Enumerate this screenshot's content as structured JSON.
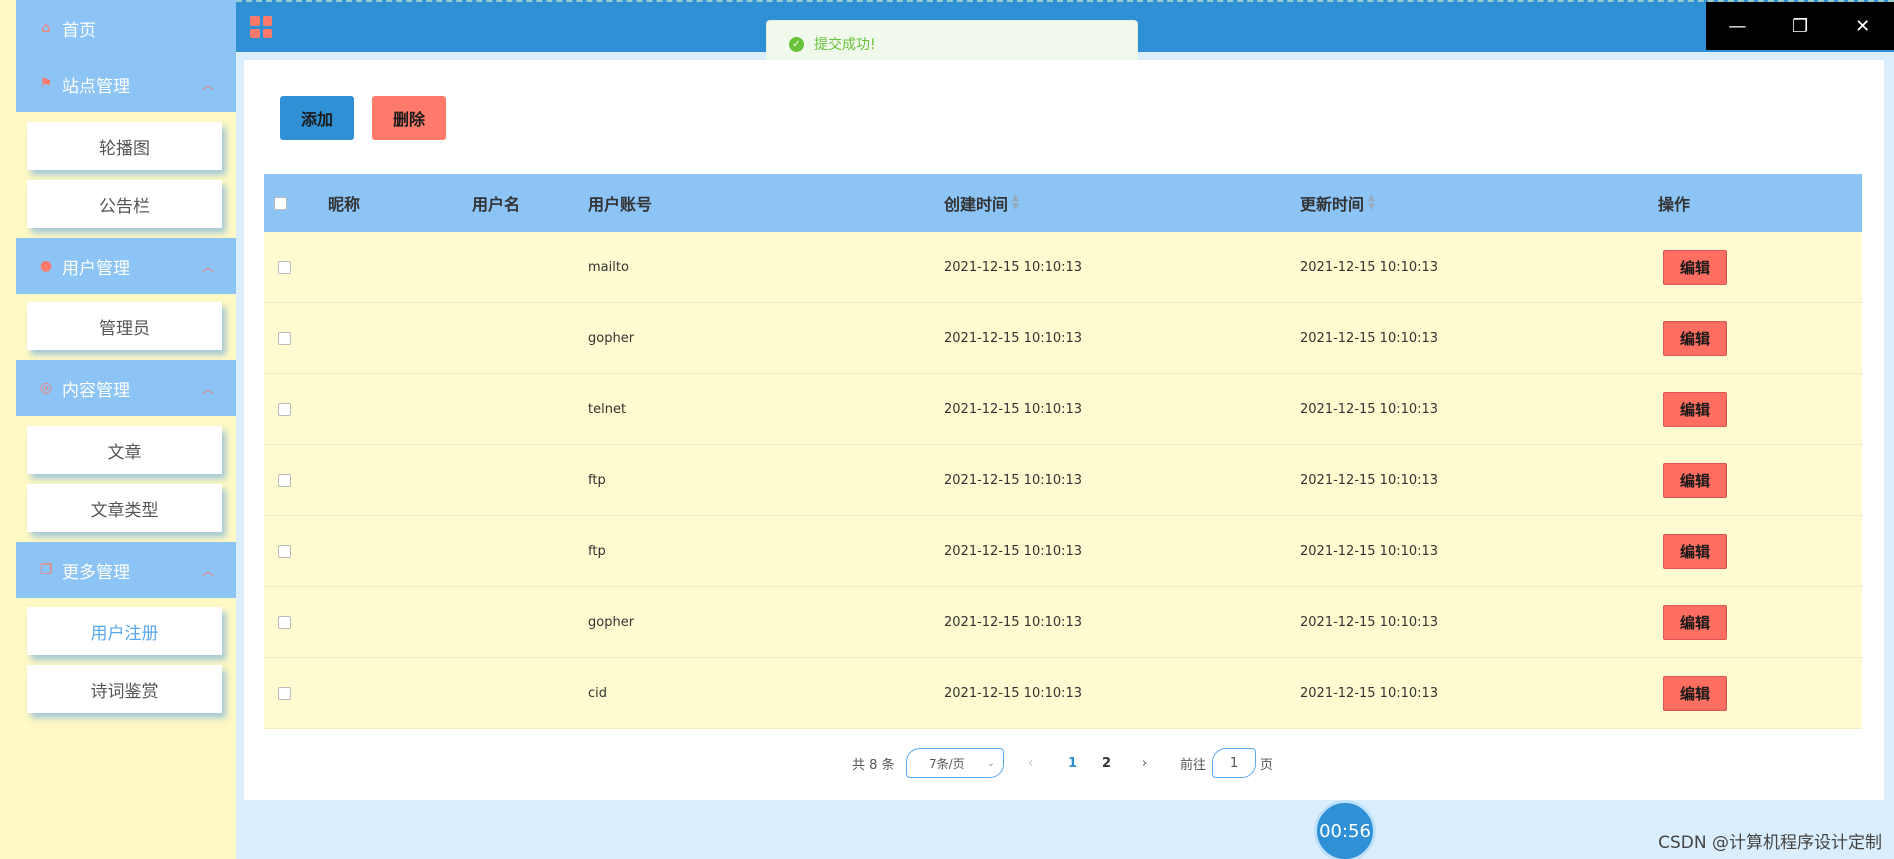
{
  "sidebar": {
    "home": "首页",
    "groups": [
      {
        "label": "站点管理",
        "items": [
          "轮播图",
          "公告栏"
        ]
      },
      {
        "label": "用户管理",
        "items": [
          "管理员"
        ]
      },
      {
        "label": "内容管理",
        "items": [
          "文章",
          "文章类型"
        ]
      },
      {
        "label": "更多管理",
        "items": [
          "用户注册",
          "诗词鉴赏"
        ]
      }
    ]
  },
  "toast": {
    "message": "提交成功!"
  },
  "toolbar": {
    "add_label": "添加",
    "delete_label": "删除"
  },
  "table": {
    "columns": [
      "昵称",
      "用户名",
      "用户账号",
      "创建时间",
      "更新时间",
      "操作"
    ],
    "rows": [
      {
        "nickname": "",
        "username": "",
        "account": "mailto",
        "created": "2021-12-15 10:10:13",
        "updated": "2021-12-15 10:10:13",
        "action": "编辑"
      },
      {
        "nickname": "",
        "username": "",
        "account": "gopher",
        "created": "2021-12-15 10:10:13",
        "updated": "2021-12-15 10:10:13",
        "action": "编辑"
      },
      {
        "nickname": "",
        "username": "",
        "account": "telnet",
        "created": "2021-12-15 10:10:13",
        "updated": "2021-12-15 10:10:13",
        "action": "编辑"
      },
      {
        "nickname": "",
        "username": "",
        "account": "ftp",
        "created": "2021-12-15 10:10:13",
        "updated": "2021-12-15 10:10:13",
        "action": "编辑"
      },
      {
        "nickname": "",
        "username": "",
        "account": "ftp",
        "created": "2021-12-15 10:10:13",
        "updated": "2021-12-15 10:10:13",
        "action": "编辑"
      },
      {
        "nickname": "",
        "username": "",
        "account": "gopher",
        "created": "2021-12-15 10:10:13",
        "updated": "2021-12-15 10:10:13",
        "action": "编辑"
      },
      {
        "nickname": "",
        "username": "",
        "account": "cid",
        "created": "2021-12-15 10:10:13",
        "updated": "2021-12-15 10:10:13",
        "action": "编辑"
      }
    ]
  },
  "pagination": {
    "total": "共 8 条",
    "page_size": "7条/页",
    "pages": [
      "1",
      "2"
    ],
    "goto_prefix": "前往",
    "goto_value": "1",
    "goto_suffix": "页"
  },
  "timer": "00:56",
  "watermark": "CSDN @计算机程序设计定制",
  "colors": {
    "primary": "#2f90d6",
    "danger": "#ff7a6a",
    "row_bg": "#fefbd0",
    "header_bg": "#8cc4f6",
    "success": "#67c23a"
  }
}
